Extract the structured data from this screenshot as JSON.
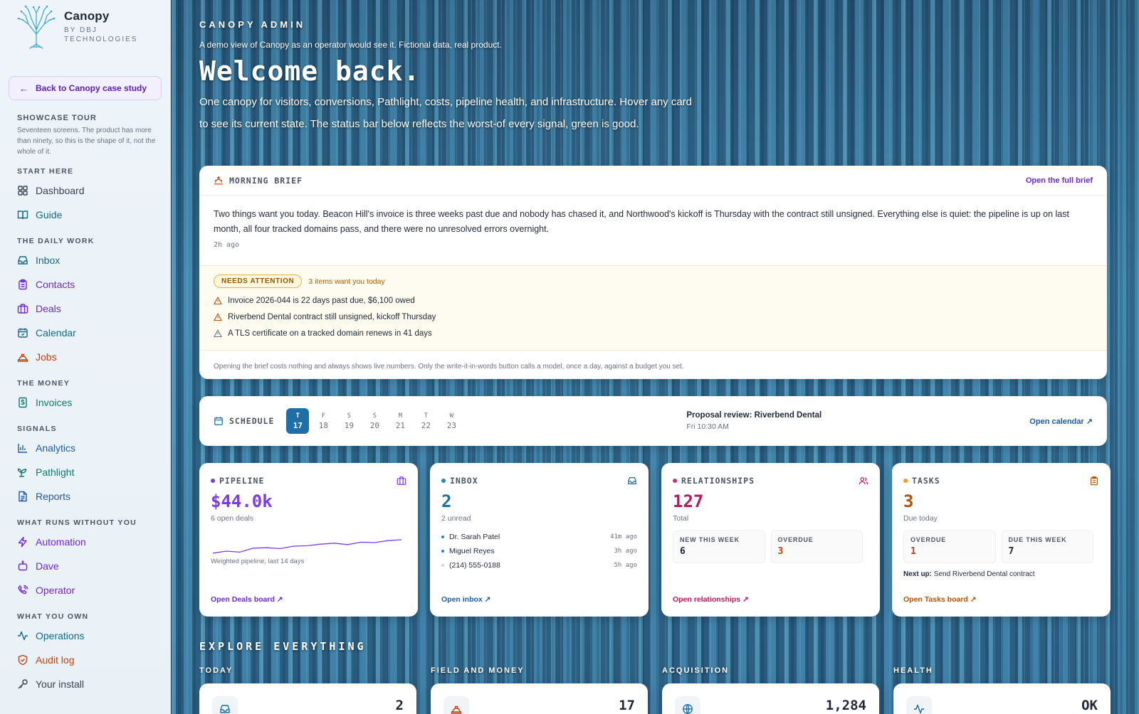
{
  "brand": {
    "name": "Canopy",
    "sub1": "BY DBJ",
    "sub2": "TECHNOLOGIES"
  },
  "sidebar": {
    "back_label": "Back to Canopy case study",
    "tour_title": "SHOWCASE TOUR",
    "tour_desc": "Seventeen screens. The product has more than ninety, so this is the shape of it, not the whole of it.",
    "sections": {
      "start_here": "START HERE",
      "daily_work": "THE DAILY WORK",
      "money": "THE MONEY",
      "signals": "SIGNALS",
      "runs_without": "WHAT RUNS WITHOUT YOU",
      "you_own": "WHAT YOU OWN"
    },
    "items": {
      "dashboard": "Dashboard",
      "guide": "Guide",
      "inbox": "Inbox",
      "contacts": "Contacts",
      "deals": "Deals",
      "calendar": "Calendar",
      "jobs": "Jobs",
      "invoices": "Invoices",
      "analytics": "Analytics",
      "pathlight": "Pathlight",
      "reports": "Reports",
      "automation": "Automation",
      "dave": "Dave",
      "operator": "Operator",
      "operations": "Operations",
      "audit_log": "Audit log",
      "your_install": "Your install"
    }
  },
  "hero": {
    "kicker": "CANOPY ADMIN",
    "demo": "A demo view of Canopy as an operator would see it. Fictional data, real product.",
    "title": "Welcome back.",
    "desc": "One canopy for visitors, conversions, Pathlight, costs, pipeline health, and infrastructure. Hover any card to see its current state. The status bar below reflects the worst-of every signal, green is good."
  },
  "brief": {
    "label": "MORNING BRIEF",
    "link": "Open the full brief",
    "text": "Two things want you today. Beacon Hill's invoice is three weeks past due and nobody has chased it, and Northwood's kickoff is Thursday with the contract still unsigned. Everything else is quiet: the pipeline is up on last month, all four tracked domains pass, and there were no unresolved errors overnight.",
    "ago": "2h ago",
    "attention_badge": "NEEDS ATTENTION",
    "attention_count": "3 items want you today",
    "attention_items": [
      "Invoice 2026-044 is 22 days past due, $6,100 owed",
      "Riverbend Dental contract still unsigned, kickoff Thursday",
      "A TLS certificate on a tracked domain renews in 41 days"
    ],
    "footer": "Opening the brief costs nothing and always shows live numbers. Only the write-it-in-words button calls a model, once a day, against a budget you set."
  },
  "schedule": {
    "label": "SCHEDULE",
    "days": [
      {
        "d": "T",
        "n": "17",
        "active": true
      },
      {
        "d": "F",
        "n": "18"
      },
      {
        "d": "S",
        "n": "19"
      },
      {
        "d": "S",
        "n": "20"
      },
      {
        "d": "M",
        "n": "21"
      },
      {
        "d": "T",
        "n": "22"
      },
      {
        "d": "W",
        "n": "23"
      }
    ],
    "event_title": "Proposal review: Riverbend Dental",
    "event_time": "Fri 10:30 AM",
    "link": "Open calendar"
  },
  "pipeline": {
    "label": "PIPELINE",
    "value": "$44.0k",
    "sub": "6 open deals",
    "caption": "Weighted pipeline, last 14 days",
    "link": "Open Deals board",
    "spark": [
      0.15,
      0.25,
      0.2,
      0.4,
      0.42,
      0.38,
      0.5,
      0.52,
      0.6,
      0.65,
      0.58,
      0.7,
      0.68,
      0.78,
      0.82
    ],
    "color": "#7c3aed"
  },
  "inbox": {
    "label": "INBOX",
    "value": "2",
    "sub": "2 unread",
    "messages": [
      {
        "from": "Dr. Sarah Patel",
        "time": "41m ago",
        "unread": true
      },
      {
        "from": "Miguel Reyes",
        "time": "3h ago",
        "unread": true
      },
      {
        "from": "(214) 555-0188",
        "time": "5h ago",
        "unread": false
      }
    ],
    "link": "Open inbox",
    "color": "#1e6fa8"
  },
  "relationships": {
    "label": "RELATIONSHIPS",
    "value": "127",
    "sub": "Total",
    "box1_k": "NEW THIS WEEK",
    "box1_v": "6",
    "box2_k": "OVERDUE",
    "box2_v": "3",
    "link": "Open relationships",
    "color": "#be185d"
  },
  "tasks": {
    "label": "TASKS",
    "value": "3",
    "sub": "Due today",
    "box1_k": "OVERDUE",
    "box1_v": "1",
    "box2_k": "DUE THIS WEEK",
    "box2_v": "7",
    "next_label": "Next up:",
    "next_text": "Send Riverbend Dental contract",
    "link": "Open Tasks board",
    "color": "#b45309"
  },
  "explore": {
    "title": "EXPLORE EVERYTHING",
    "groups": [
      {
        "label": "TODAY",
        "value": "2"
      },
      {
        "label": "FIELD AND MONEY",
        "value": "17"
      },
      {
        "label": "ACQUISITION",
        "value": "1,284"
      },
      {
        "label": "HEALTH",
        "value": "OK"
      }
    ]
  }
}
